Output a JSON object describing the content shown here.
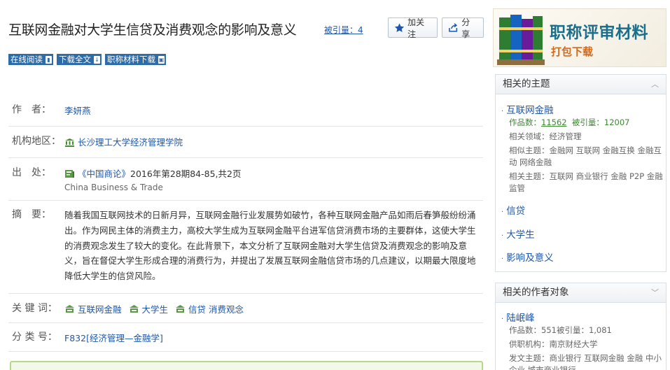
{
  "title": "互联网金融对大学生信贷及消费观念的影响及意义",
  "cited": "被引量：4",
  "buttons": {
    "follow": "加关注",
    "share": "分享"
  },
  "tags": [
    "在线阅读",
    "下载全文",
    "职称材料下载"
  ],
  "fields": {
    "author_label": "作　者：",
    "author": "李妍燕",
    "org_label": "机构地区：",
    "org": "长沙理工大学经济管理学院",
    "source_label": "出　处：",
    "source_journal": "《中国商论》",
    "source_detail": "2016年第28期84-85,共2页",
    "source_en": "China Business & Trade",
    "abstract_label": "摘　要：",
    "abstract": "随着我国互联网技术的日新月异，互联网金融行业发展势如破竹，各种互联网金融产品如雨后春笋般纷纷涌出。作为网民主体的消费主力，高校大学生成为互联网金融平台进军信贷消费市场的主要群体，这使大学生的消费观念发生了较大的变化。在此背景下，本文分析了互联网金融对大学生信贷及消费观念的影响及意义，旨在督促大学生形成合理的消费行为，并提出了发展互联网金融信贷市场的几点建议，以期最大限度地降低大学生的信贷风险。",
    "keywords_label": "关 键 词：",
    "keywords": [
      "互联网金融",
      "大学生",
      "信贷"
    ],
    "keywords_extra": "消费观念",
    "class_label": "分 类 号：",
    "class_code": "F832",
    "class_name": "[经济管理—金融学]"
  },
  "banner": {
    "line1": "职称评审材料",
    "line2": "打包下载"
  },
  "related_topics": {
    "header": "相关的主题",
    "items": [
      {
        "name": "互联网金融",
        "works_label": "作品数：",
        "works": "11562",
        "cited_label": "被引量：",
        "cited": "12007",
        "field": "相关领域：经济管理",
        "similar": "相似主题：金融网 互联网 金融互换 金融互动 网络金融",
        "related": "相关主题：互联网 商业银行 金融 P2P 金融监管"
      },
      {
        "name": "信贷"
      },
      {
        "name": "大学生"
      },
      {
        "name": "影响及意义"
      }
    ]
  },
  "related_authors": {
    "header": "相关的作者对象",
    "items": [
      {
        "name": "陆岷峰",
        "stats": "作品数：551被引量：1,081",
        "org": "供职机构：南京财经大学",
        "topics": "发文主题：商业银行 互联网金融 金融 中小企业 城市商业银行"
      }
    ]
  },
  "colors": {
    "link": "#1f57a8",
    "tag_bg": "#2d6ca8",
    "green": "#3a8a2e",
    "banner_title": "#1a6f8c",
    "banner_sub": "#d46a1c"
  }
}
